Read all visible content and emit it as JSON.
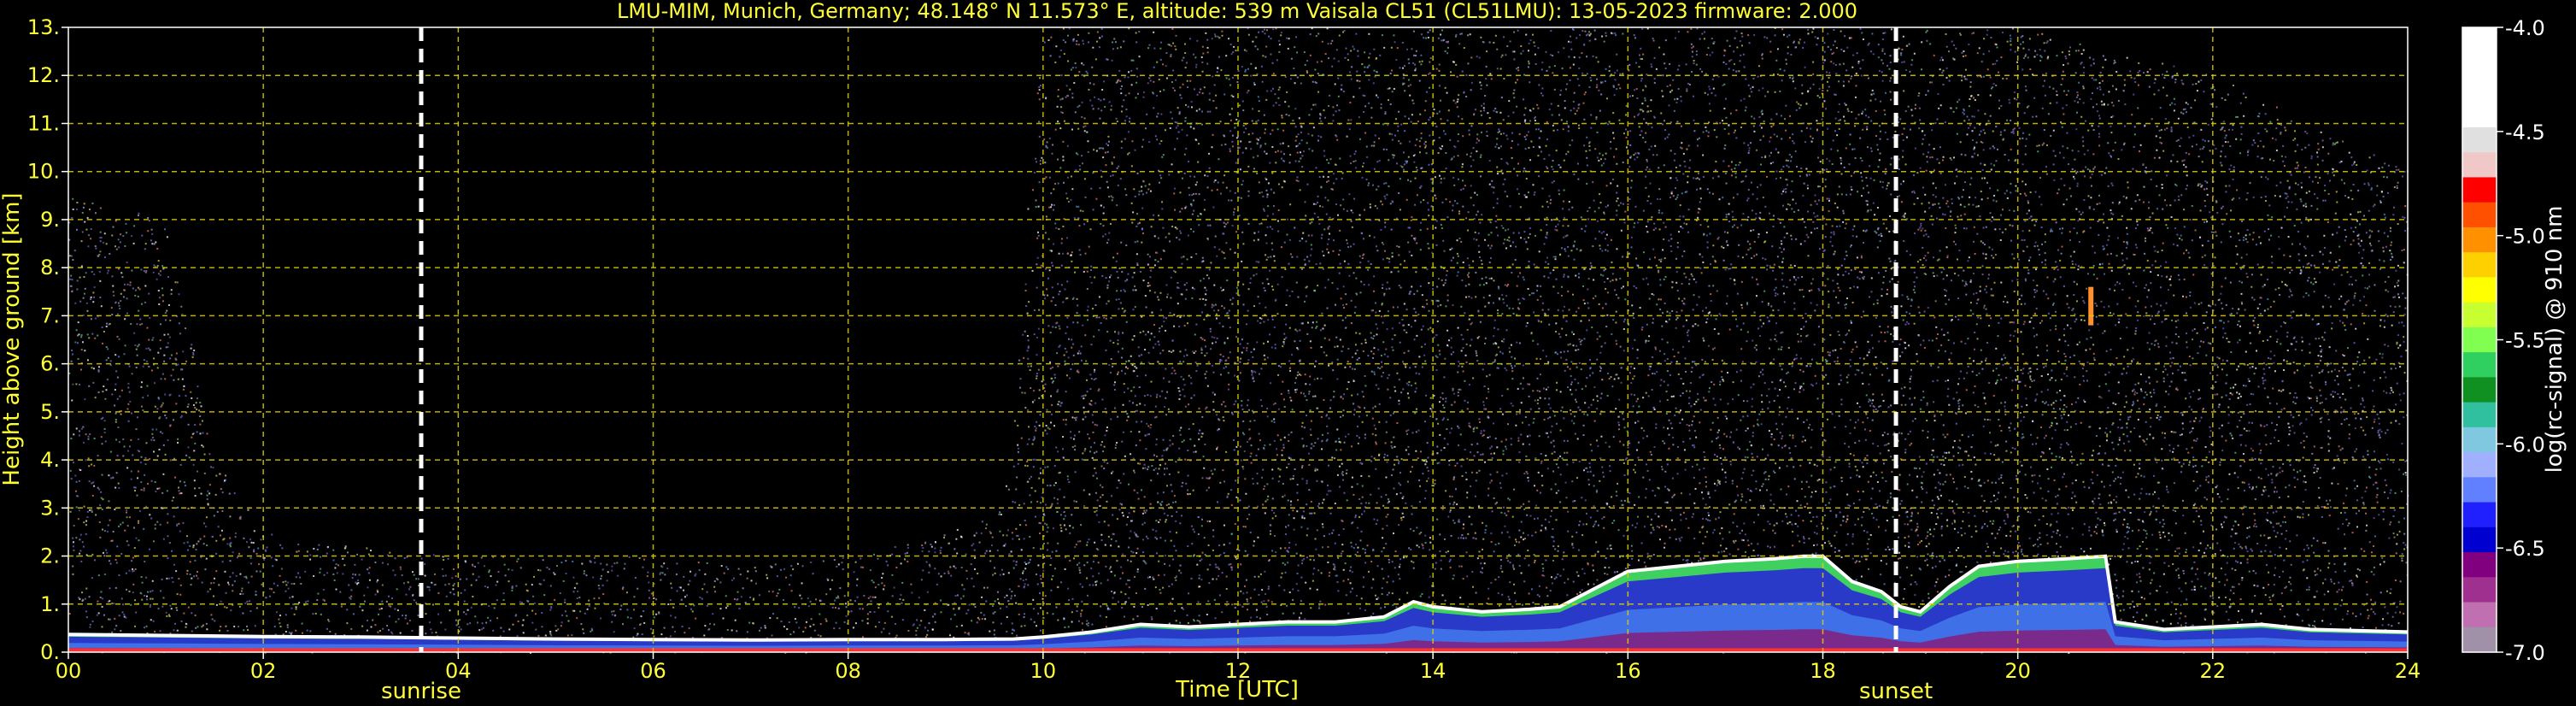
{
  "chart_data": {
    "type": "heatmap",
    "title": "LMU-MIM, Munich, Germany; 48.148° N 11.573° E, altitude: 539 m    Vaisala CL51 (CL51LMU): 13-05-2023    firmware: 2.000",
    "xlabel": "Time [UTC]",
    "ylabel": "Height above ground [km]",
    "colorbar_label": "log(rc-signal) @ 910 nm",
    "xlim": [
      0,
      24
    ],
    "ylim": [
      0,
      13
    ],
    "x_ticks": [
      "00",
      "02",
      "04",
      "06",
      "08",
      "10",
      "12",
      "14",
      "16",
      "18",
      "20",
      "22",
      "24"
    ],
    "y_ticks": [
      "0.",
      "1.",
      "2.",
      "3.",
      "4.",
      "5.",
      "6.",
      "7.",
      "8.",
      "9.",
      "10.",
      "11.",
      "12.",
      "13."
    ],
    "grid": true,
    "colorbar_range": [
      -7.0,
      -4.0
    ],
    "colorbar_ticks": [
      "-4.0",
      "-4.5",
      "-5.0",
      "-5.5",
      "-6.0",
      "-6.5",
      "-7.0"
    ],
    "colorbar_colors": [
      "#ffffff",
      "#ffffff",
      "#ffffff",
      "#ffffff",
      "#e0e0e0",
      "#f0c8c8",
      "#ff0000",
      "#ff5000",
      "#ff9000",
      "#ffd000",
      "#ffff00",
      "#c8ff30",
      "#80ff50",
      "#30d060",
      "#109020",
      "#30c0a0",
      "#80c8e0",
      "#a0b0ff",
      "#6080ff",
      "#2020ff",
      "#0000d0",
      "#800080",
      "#a03090",
      "#c070b0",
      "#a090a8"
    ],
    "markers": [
      {
        "label": "sunrise",
        "x": 3.62
      },
      {
        "label": "sunset",
        "x": 18.75
      }
    ],
    "boundary_layer": [
      [
        0,
        0.35
      ],
      [
        1,
        0.33
      ],
      [
        2,
        0.31
      ],
      [
        3,
        0.3
      ],
      [
        4,
        0.28
      ],
      [
        5,
        0.26
      ],
      [
        6,
        0.25
      ],
      [
        7,
        0.24
      ],
      [
        8,
        0.25
      ],
      [
        9,
        0.25
      ],
      [
        9.7,
        0.26
      ],
      [
        10,
        0.3
      ],
      [
        10.5,
        0.4
      ],
      [
        11,
        0.55
      ],
      [
        11.5,
        0.5
      ],
      [
        12,
        0.55
      ],
      [
        12.5,
        0.6
      ],
      [
        13,
        0.6
      ],
      [
        13.5,
        0.7
      ],
      [
        13.8,
        1.0
      ],
      [
        14,
        0.9
      ],
      [
        14.5,
        0.8
      ],
      [
        15,
        0.85
      ],
      [
        15.3,
        0.9
      ],
      [
        15.6,
        1.2
      ],
      [
        16,
        1.6
      ],
      [
        16.5,
        1.7
      ],
      [
        17,
        1.8
      ],
      [
        17.5,
        1.85
      ],
      [
        17.8,
        1.9
      ],
      [
        18,
        1.9
      ],
      [
        18.3,
        1.4
      ],
      [
        18.6,
        1.2
      ],
      [
        18.8,
        0.9
      ],
      [
        19,
        0.8
      ],
      [
        19.3,
        1.3
      ],
      [
        19.6,
        1.7
      ],
      [
        20,
        1.8
      ],
      [
        20.5,
        1.85
      ],
      [
        20.9,
        1.9
      ],
      [
        21,
        0.6
      ],
      [
        21.5,
        0.45
      ],
      [
        22,
        0.5
      ],
      [
        22.5,
        0.55
      ],
      [
        23,
        0.45
      ],
      [
        24,
        0.4
      ]
    ],
    "noise_height": [
      [
        0,
        9.5
      ],
      [
        1,
        9.0
      ],
      [
        1.5,
        4.0
      ],
      [
        2,
        2.5
      ],
      [
        3,
        2.2
      ],
      [
        4,
        2.0
      ],
      [
        5,
        2.0
      ],
      [
        6,
        2.0
      ],
      [
        7,
        1.8
      ],
      [
        8,
        2.0
      ],
      [
        9,
        2.5
      ],
      [
        9.6,
        3.0
      ],
      [
        10,
        13
      ],
      [
        12,
        13
      ],
      [
        14,
        13
      ],
      [
        16,
        13
      ],
      [
        18,
        13
      ],
      [
        19,
        13
      ],
      [
        20,
        13
      ],
      [
        22,
        12
      ],
      [
        24,
        10
      ]
    ],
    "aerosol_feature": {
      "x": 20.75,
      "y_bottom": 6.8,
      "y_top": 7.6
    }
  }
}
